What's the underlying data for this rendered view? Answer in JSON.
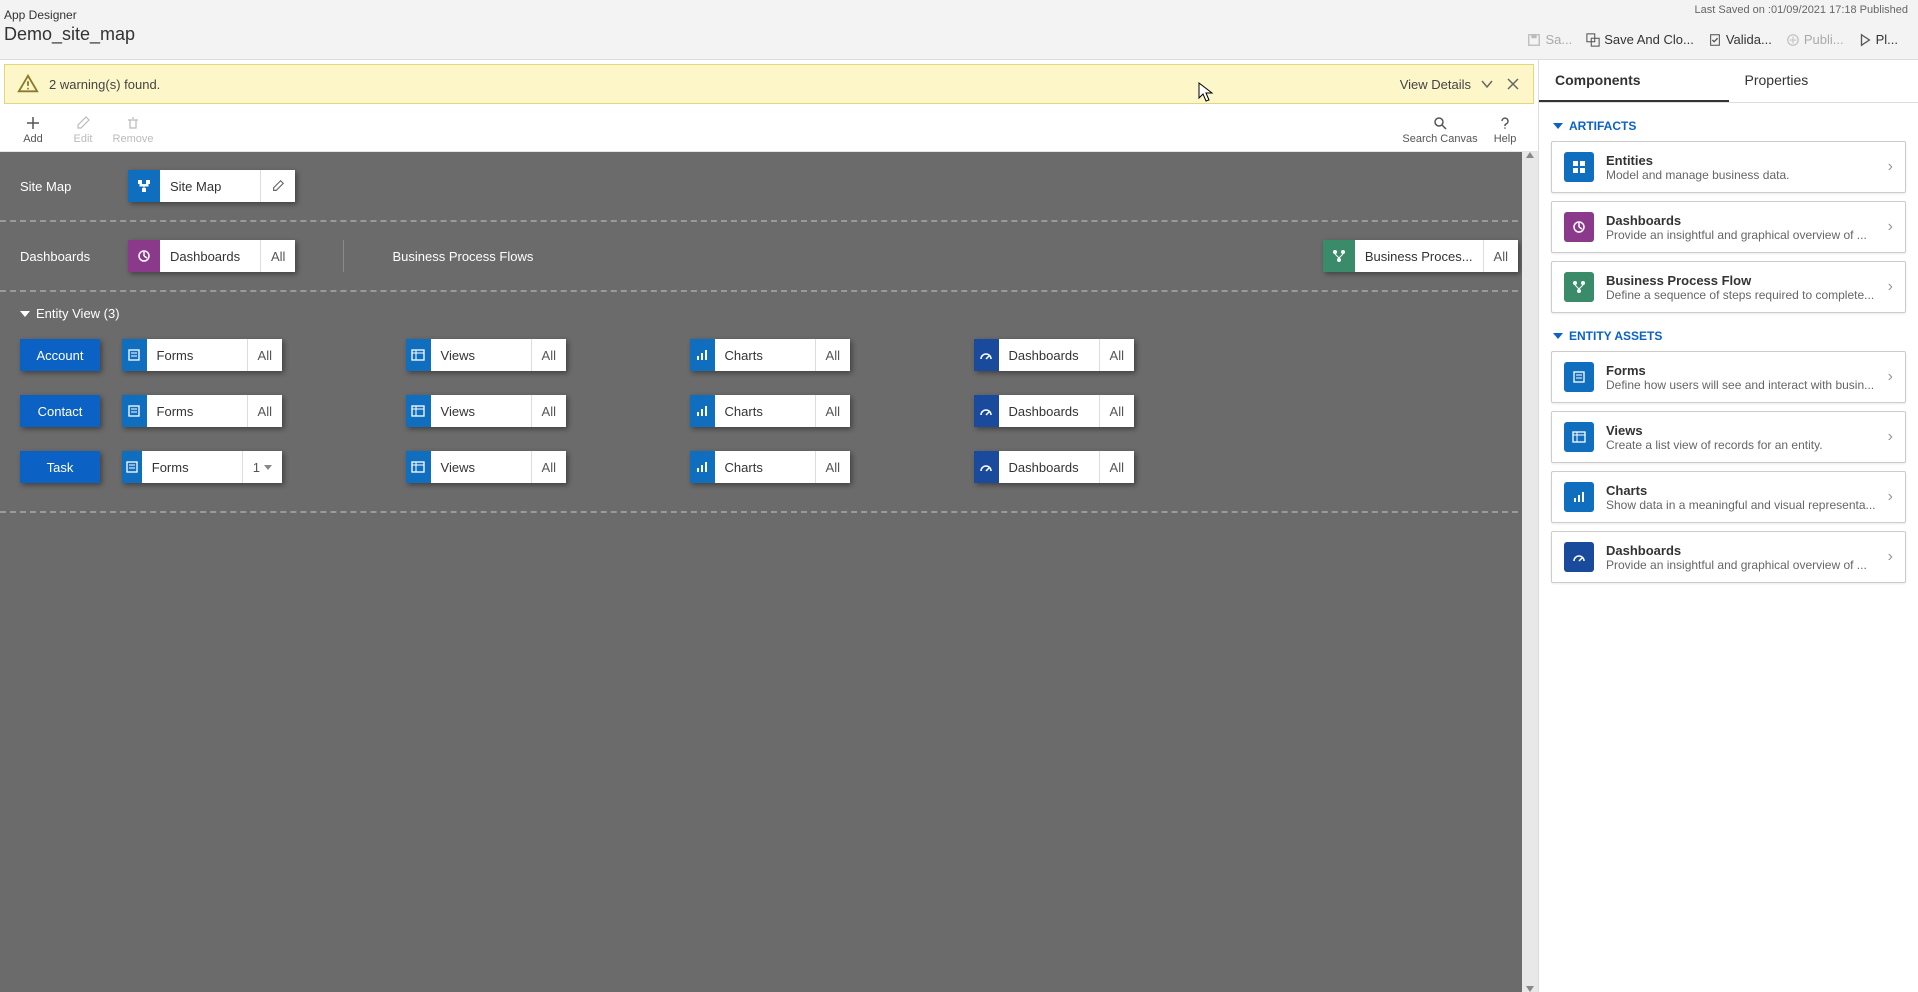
{
  "header": {
    "app_title": "App Designer",
    "app_name": "Demo_site_map",
    "last_saved": "Last Saved on :01/09/2021 17:18 Published",
    "buttons": {
      "save": "Sa...",
      "save_close": "Save And Clo...",
      "validate": "Valida...",
      "publish": "Publi...",
      "play": "Pl..."
    }
  },
  "warning": {
    "text": "2 warning(s) found.",
    "view_details": "View Details"
  },
  "toolbar": {
    "add": "Add",
    "edit": "Edit",
    "remove": "Remove",
    "search": "Search Canvas",
    "help": "Help"
  },
  "canvas": {
    "sitemap_label": "Site Map",
    "sitemap_tile": "Site Map",
    "dashboards_label": "Dashboards",
    "dashboards_tile": "Dashboards",
    "dashboards_all": "All",
    "bpf_label": "Business Process Flows",
    "bpf_tile": "Business Proces...",
    "bpf_all": "All",
    "entity_header": "Entity View (3)",
    "entities": [
      {
        "name": "Account",
        "forms_count": "All"
      },
      {
        "name": "Contact",
        "forms_count": "All"
      },
      {
        "name": "Task",
        "forms_count": "1"
      }
    ],
    "col_forms": "Forms",
    "col_views": "Views",
    "col_charts": "Charts",
    "col_dashboards": "Dashboards",
    "all": "All"
  },
  "sidebar": {
    "tabs": {
      "components": "Components",
      "properties": "Properties"
    },
    "group_artifacts": "ARTIFACTS",
    "group_assets": "ENTITY ASSETS",
    "cards": {
      "entities": {
        "title": "Entities",
        "desc": "Model and manage business data."
      },
      "dashboards": {
        "title": "Dashboards",
        "desc": "Provide an insightful and graphical overview of ..."
      },
      "bpf": {
        "title": "Business Process Flow",
        "desc": "Define a sequence of steps required to complete..."
      },
      "forms": {
        "title": "Forms",
        "desc": "Define how users will see and interact with busin..."
      },
      "views": {
        "title": "Views",
        "desc": "Create a list view of records for an entity."
      },
      "charts": {
        "title": "Charts",
        "desc": "Show data in a meaningful and visual representa..."
      },
      "dash2": {
        "title": "Dashboards",
        "desc": "Provide an insightful and graphical overview of ..."
      }
    }
  }
}
